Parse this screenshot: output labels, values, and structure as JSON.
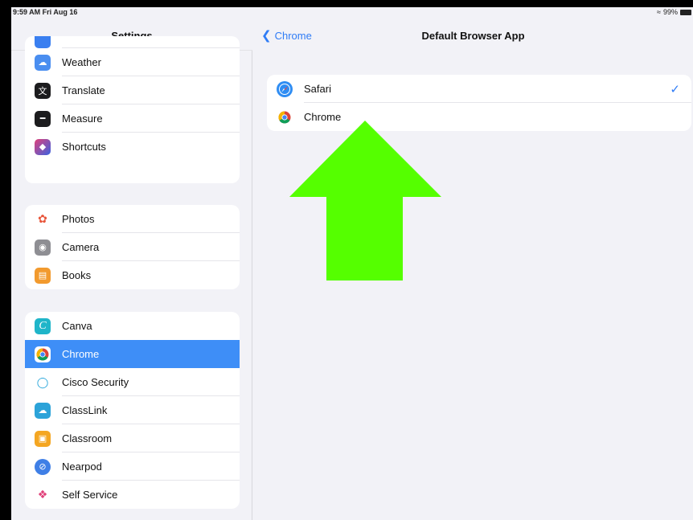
{
  "status_bar": {
    "time": "9:59 AM  Fri Aug 16",
    "battery": "99%"
  },
  "sidebar": {
    "title": "Settings",
    "groups": [
      {
        "items": [
          {
            "label": "Weather",
            "icon": "weather-icon",
            "color": "#4a8ef0"
          },
          {
            "label": "Translate",
            "icon": "translate-icon",
            "color": "#1c1c1e"
          },
          {
            "label": "Measure",
            "icon": "measure-icon",
            "color": "#1c1c1e"
          },
          {
            "label": "Shortcuts",
            "icon": "shortcuts-icon",
            "color": "#5b3fd6"
          }
        ]
      },
      {
        "items": [
          {
            "label": "Photos",
            "icon": "photos-icon",
            "color": "#ffffff"
          },
          {
            "label": "Camera",
            "icon": "camera-icon",
            "color": "#8e8e93"
          },
          {
            "label": "Books",
            "icon": "books-icon",
            "color": "#f29a2e"
          }
        ]
      },
      {
        "items": [
          {
            "label": "Canva",
            "icon": "canva-icon",
            "color": "#1fb5c9"
          },
          {
            "label": "Chrome",
            "icon": "chrome-icon",
            "color": "#ffffff"
          },
          {
            "label": "Cisco Security",
            "icon": "cisco-security-icon",
            "color": "#ffffff"
          },
          {
            "label": "ClassLink",
            "icon": "classlink-icon",
            "color": "#2ca3d9"
          },
          {
            "label": "Classroom",
            "icon": "classroom-icon",
            "color": "#f4a622"
          },
          {
            "label": "Nearpod",
            "icon": "nearpod-icon",
            "color": "#3f7fe6"
          },
          {
            "label": "Self Service",
            "icon": "self-service-icon",
            "color": "#ffffff"
          }
        ]
      }
    ],
    "selected": "Chrome"
  },
  "detail": {
    "back_label": "Chrome",
    "title": "Default Browser App",
    "options": [
      {
        "label": "Safari",
        "icon": "safari-icon",
        "checked": true
      },
      {
        "label": "Chrome",
        "icon": "chrome-icon",
        "checked": false
      }
    ]
  },
  "overlay": {
    "arrow_color": "#55ff00",
    "arrow_direction": "up"
  }
}
